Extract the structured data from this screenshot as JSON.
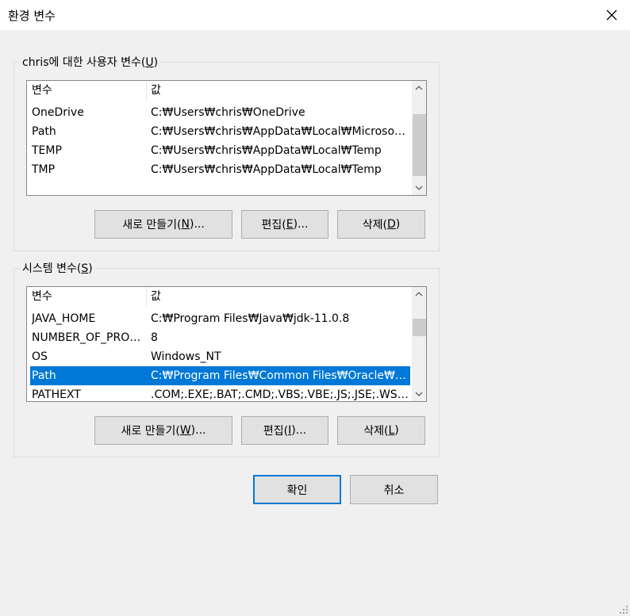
{
  "window": {
    "title": "환경 변수"
  },
  "user_vars": {
    "label_pre": "chris에 대한 사용자 변수(",
    "label_key": "U",
    "label_post": ")",
    "col_name": "변수",
    "col_value": "값",
    "rows": [
      {
        "name": "OneDrive",
        "value": "C:₩Users₩chris₩OneDrive"
      },
      {
        "name": "Path",
        "value": "C:₩Users₩chris₩AppData₩Local₩Microsoft₩..."
      },
      {
        "name": "TEMP",
        "value": "C:₩Users₩chris₩AppData₩Local₩Temp"
      },
      {
        "name": "TMP",
        "value": "C:₩Users₩chris₩AppData₩Local₩Temp"
      }
    ],
    "new_pre": "새로 만들기(",
    "new_key": "N",
    "new_post": ")...",
    "edit_pre": "편집(",
    "edit_key": "E",
    "edit_post": ")...",
    "delete_pre": "삭제(",
    "delete_key": "D",
    "delete_post": ")"
  },
  "system_vars": {
    "label_pre": "시스템 변수(",
    "label_key": "S",
    "label_post": ")",
    "col_name": "변수",
    "col_value": "값",
    "rows": [
      {
        "name": "JAVA_HOME",
        "value": "C:₩Program Files₩Java₩jdk-11.0.8"
      },
      {
        "name": "NUMBER_OF_PROC...",
        "value": "8"
      },
      {
        "name": "OS",
        "value": "Windows_NT"
      },
      {
        "name": "Path",
        "value": "C:₩Program Files₩Common Files₩Oracle₩Ja..."
      },
      {
        "name": "PATHEXT",
        "value": ".COM;.EXE;.BAT;.CMD;.VBS;.VBE;.JS;.JSE;.WSF;...."
      }
    ],
    "new_pre": "새로 만들기(",
    "new_key": "W",
    "new_post": ")...",
    "edit_pre": "편집(",
    "edit_key": "I",
    "edit_post": ")...",
    "delete_pre": "삭제(",
    "delete_key": "L",
    "delete_post": ")"
  },
  "footer": {
    "ok_label": "확인",
    "cancel_label": "취소"
  },
  "colors": {
    "selection": "#0078d7",
    "default_button_border": "#0078d7"
  }
}
